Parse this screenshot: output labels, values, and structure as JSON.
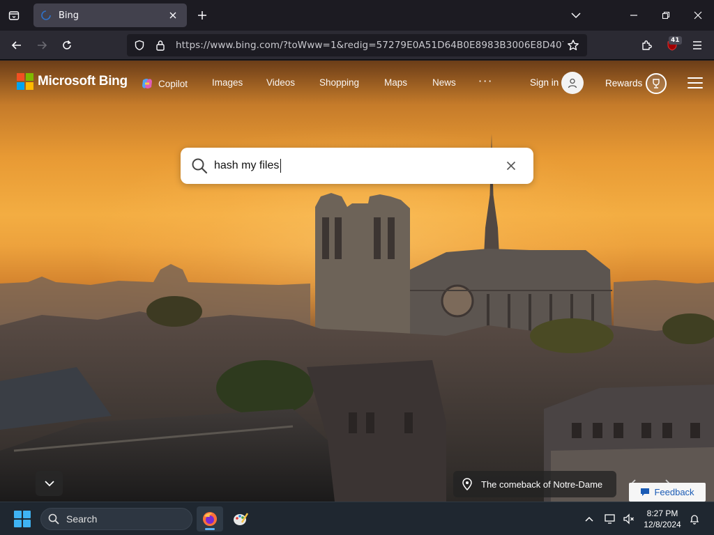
{
  "browser": {
    "tab": {
      "title": "Bing"
    },
    "url": "https://www.bing.com/?toWww=1&redig=57279E0A51D64B0E8983B3006E8D4075",
    "extension_badge": "41"
  },
  "bing": {
    "logo_text": "Microsoft Bing",
    "nav": {
      "copilot": "Copilot",
      "images": "Images",
      "videos": "Videos",
      "shopping": "Shopping",
      "maps": "Maps",
      "news": "News",
      "more": "···"
    },
    "sign_in": "Sign in",
    "rewards": "Rewards",
    "search": {
      "value": "hash my files"
    },
    "caption": "The comeback of Notre-Dame",
    "feedback": "Feedback",
    "logo_colors": [
      "#f25022",
      "#7fba00",
      "#00a4ef",
      "#ffb900"
    ]
  },
  "taskbar": {
    "search_placeholder": "Search",
    "time": "8:27 PM",
    "date": "12/8/2024"
  }
}
